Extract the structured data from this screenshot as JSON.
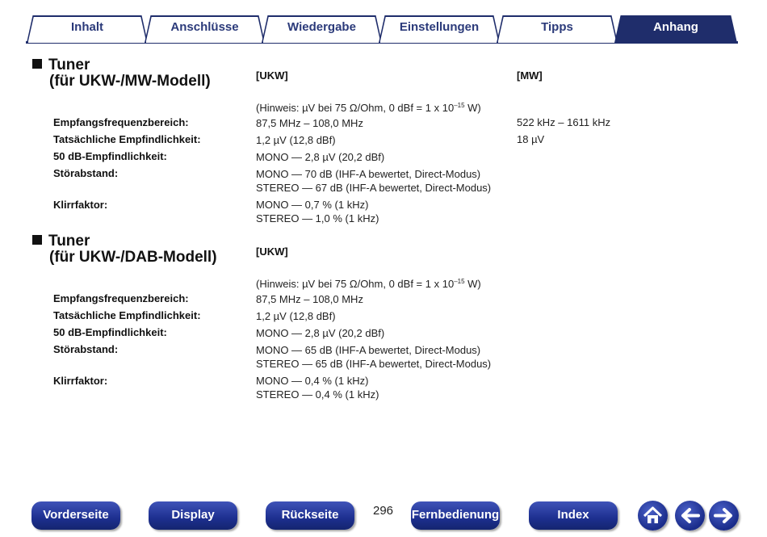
{
  "tabs": [
    {
      "label": "Inhalt",
      "active": false
    },
    {
      "label": "Anschlüsse",
      "active": false
    },
    {
      "label": "Wiedergabe",
      "active": false
    },
    {
      "label": "Einstellungen",
      "active": false
    },
    {
      "label": "Tipps",
      "active": false
    },
    {
      "label": "Anhang",
      "active": true
    }
  ],
  "section1": {
    "title_line1": "Tuner",
    "title_line2": "(für UKW-/MW-Modell)",
    "col_ukw": "[UKW]",
    "col_mw": "[MW]",
    "hint_prefix": "(Hinweis: µV bei 75 Ω/Ohm, 0 dBf = 1 x 10",
    "hint_exp": "–15",
    "hint_suffix": " W)",
    "rows": [
      {
        "label": "Empfangsfrequenzbereich:",
        "ukw": "87,5 MHz – 108,0 MHz",
        "mw": "522 kHz – 1611 kHz"
      },
      {
        "label": "Tatsächliche Empfindlichkeit:",
        "ukw": "1,2 µV (12,8 dBf)",
        "mw": "18 µV"
      },
      {
        "label": "50 dB-Empfindlichkeit:",
        "ukw": "MONO — 2,8 µV (20,2 dBf)"
      },
      {
        "label": "Störabstand:",
        "ukw": "MONO — 70 dB (IHF-A bewertet, Direct-Modus)",
        "ukw2": "STEREO — 67 dB (IHF-A bewertet, Direct-Modus)"
      },
      {
        "label": "Klirrfaktor:",
        "ukw": "MONO — 0,7 % (1 kHz)",
        "ukw2": "STEREO — 1,0 % (1 kHz)"
      }
    ]
  },
  "section2": {
    "title_line1": "Tuner",
    "title_line2": "(für UKW-/DAB-Modell)",
    "col_ukw": "[UKW]",
    "hint_prefix": "(Hinweis: µV bei 75 Ω/Ohm, 0 dBf = 1 x 10",
    "hint_exp": "–15",
    "hint_suffix": " W)",
    "rows": [
      {
        "label": "Empfangsfrequenzbereich:",
        "ukw": "87,5 MHz – 108,0 MHz"
      },
      {
        "label": "Tatsächliche Empfindlichkeit:",
        "ukw": "1,2 µV (12,8 dBf)"
      },
      {
        "label": "50 dB-Empfindlichkeit:",
        "ukw": "MONO — 2,8 µV (20,2 dBf)"
      },
      {
        "label": "Störabstand:",
        "ukw": "MONO — 65 dB (IHF-A bewertet, Direct-Modus)",
        "ukw2": "STEREO — 65 dB (IHF-A bewertet, Direct-Modus)"
      },
      {
        "label": "Klirrfaktor:",
        "ukw": "MONO — 0,4 % (1 kHz)",
        "ukw2": "STEREO — 0,4 % (1 kHz)"
      }
    ]
  },
  "footer": {
    "front_page": "Vorderseite",
    "display": "Display",
    "back_page": "Rückseite",
    "page_number": "296",
    "remote": "Fernbedienung",
    "index": "Index",
    "home_icon": "home-icon",
    "back_icon": "arrow-left-icon",
    "forward_icon": "arrow-right-icon"
  },
  "colors": {
    "tab_navy": "#1f2d6b",
    "button_blue": "#1d2f8f"
  }
}
